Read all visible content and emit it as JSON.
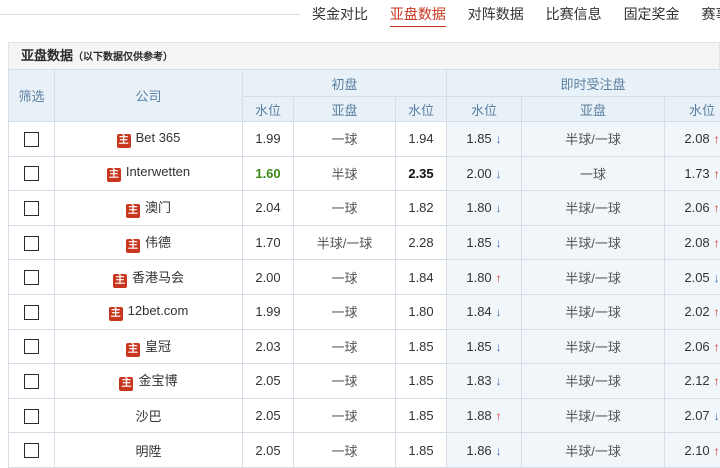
{
  "nav": {
    "tabs": [
      {
        "label": "奖金对比",
        "active": false
      },
      {
        "label": "亚盘数据",
        "active": true
      },
      {
        "label": "对阵数据",
        "active": false
      },
      {
        "label": "比赛信息",
        "active": false
      },
      {
        "label": "固定奖金",
        "active": false
      },
      {
        "label": "赛事",
        "active": false
      }
    ]
  },
  "panel": {
    "title": "亚盘数据",
    "note": "（以下数据仅供参考）"
  },
  "table": {
    "headers": {
      "select": "筛选",
      "company": "公司",
      "initial": "初盘",
      "live": "即时受注盘",
      "odds": "水位",
      "handicap": "亚盘"
    },
    "badge_label": "主",
    "rows": [
      {
        "company": "Bet 365",
        "badge": true,
        "init_home": "1.99",
        "init_hc": "一球",
        "init_away": "1.94",
        "live_home": "1.85",
        "live_home_dir": "down",
        "live_hc": "半球/一球",
        "live_away": "2.08",
        "live_away_dir": "up"
      },
      {
        "company": "Interwetten",
        "badge": true,
        "init_home": "1.60",
        "init_home_style": "green",
        "init_hc": "半球",
        "init_away": "2.35",
        "init_away_style": "bold",
        "live_home": "2.00",
        "live_home_dir": "down",
        "live_hc": "一球",
        "live_away": "1.73",
        "live_away_dir": "up"
      },
      {
        "company": "澳门",
        "badge": true,
        "init_home": "2.04",
        "init_hc": "一球",
        "init_away": "1.82",
        "live_home": "1.80",
        "live_home_dir": "down",
        "live_hc": "半球/一球",
        "live_away": "2.06",
        "live_away_dir": "up"
      },
      {
        "company": "伟德",
        "badge": true,
        "init_home": "1.70",
        "init_hc": "半球/一球",
        "init_away": "2.28",
        "live_home": "1.85",
        "live_home_dir": "down",
        "live_hc": "半球/一球",
        "live_away": "2.08",
        "live_away_dir": "up"
      },
      {
        "company": "香港马会",
        "badge": true,
        "init_home": "2.00",
        "init_hc": "一球",
        "init_away": "1.84",
        "live_home": "1.80",
        "live_home_dir": "up",
        "live_hc": "半球/一球",
        "live_away": "2.05",
        "live_away_dir": "down"
      },
      {
        "company": "12bet.com",
        "badge": true,
        "init_home": "1.99",
        "init_hc": "一球",
        "init_away": "1.80",
        "live_home": "1.84",
        "live_home_dir": "down",
        "live_hc": "半球/一球",
        "live_away": "2.02",
        "live_away_dir": "up"
      },
      {
        "company": "皇冠",
        "badge": true,
        "init_home": "2.03",
        "init_hc": "一球",
        "init_away": "1.85",
        "live_home": "1.85",
        "live_home_dir": "down",
        "live_hc": "半球/一球",
        "live_away": "2.06",
        "live_away_dir": "up"
      },
      {
        "company": "金宝博",
        "badge": true,
        "init_home": "2.05",
        "init_hc": "一球",
        "init_away": "1.85",
        "live_home": "1.83",
        "live_home_dir": "down",
        "live_hc": "半球/一球",
        "live_away": "2.12",
        "live_away_dir": "up"
      },
      {
        "company": "沙巴",
        "badge": false,
        "init_home": "2.05",
        "init_hc": "一球",
        "init_away": "1.85",
        "live_home": "1.88",
        "live_home_dir": "up",
        "live_hc": "半球/一球",
        "live_away": "2.07",
        "live_away_dir": "down"
      },
      {
        "company": "明陞",
        "badge": false,
        "init_home": "2.05",
        "init_hc": "一球",
        "init_away": "1.85",
        "live_home": "1.86",
        "live_home_dir": "down",
        "live_hc": "半球/一球",
        "live_away": "2.10",
        "live_away_dir": "up"
      }
    ]
  },
  "colors": {
    "accent_red": "#c8361f",
    "arrow_up": "#d2311b",
    "arrow_down": "#3a6db0",
    "highlight_green": "#3a8a1a"
  },
  "icons": {
    "arrow_up": "arrow-up-icon",
    "arrow_down": "arrow-down-icon"
  }
}
